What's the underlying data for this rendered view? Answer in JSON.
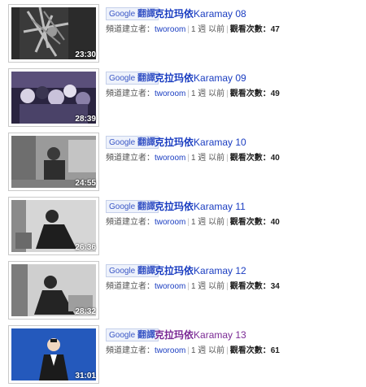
{
  "translate": {
    "brand": "Google",
    "action": "翻譯"
  },
  "meta_labels": {
    "creator": "頻道建立者：",
    "views": "觀看次數："
  },
  "videos": [
    {
      "title_cn": "克拉玛依",
      "title_en": "Karamay 08",
      "duration": "23:30",
      "user": "tworoom",
      "age": "1 週 以前",
      "views": "47",
      "visited": false
    },
    {
      "title_cn": "克拉玛依",
      "title_en": "Karamay 09",
      "duration": "28:39",
      "user": "tworoom",
      "age": "1 週 以前",
      "views": "49",
      "visited": false
    },
    {
      "title_cn": "克拉玛依",
      "title_en": "Karamay 10",
      "duration": "24:55",
      "user": "tworoom",
      "age": "1 週 以前",
      "views": "40",
      "visited": false
    },
    {
      "title_cn": "克拉玛依",
      "title_en": "Karamay 11",
      "duration": "26:36",
      "user": "tworoom",
      "age": "1 週 以前",
      "views": "40",
      "visited": false
    },
    {
      "title_cn": "克拉玛依",
      "title_en": "Karamay 12",
      "duration": "28:32",
      "user": "tworoom",
      "age": "1 週 以前",
      "views": "34",
      "visited": false
    },
    {
      "title_cn": "克拉玛依",
      "title_en": "Karamay 13",
      "duration": "31:01",
      "user": "tworoom",
      "age": "1 週 以前",
      "views": "61",
      "visited": true
    }
  ]
}
